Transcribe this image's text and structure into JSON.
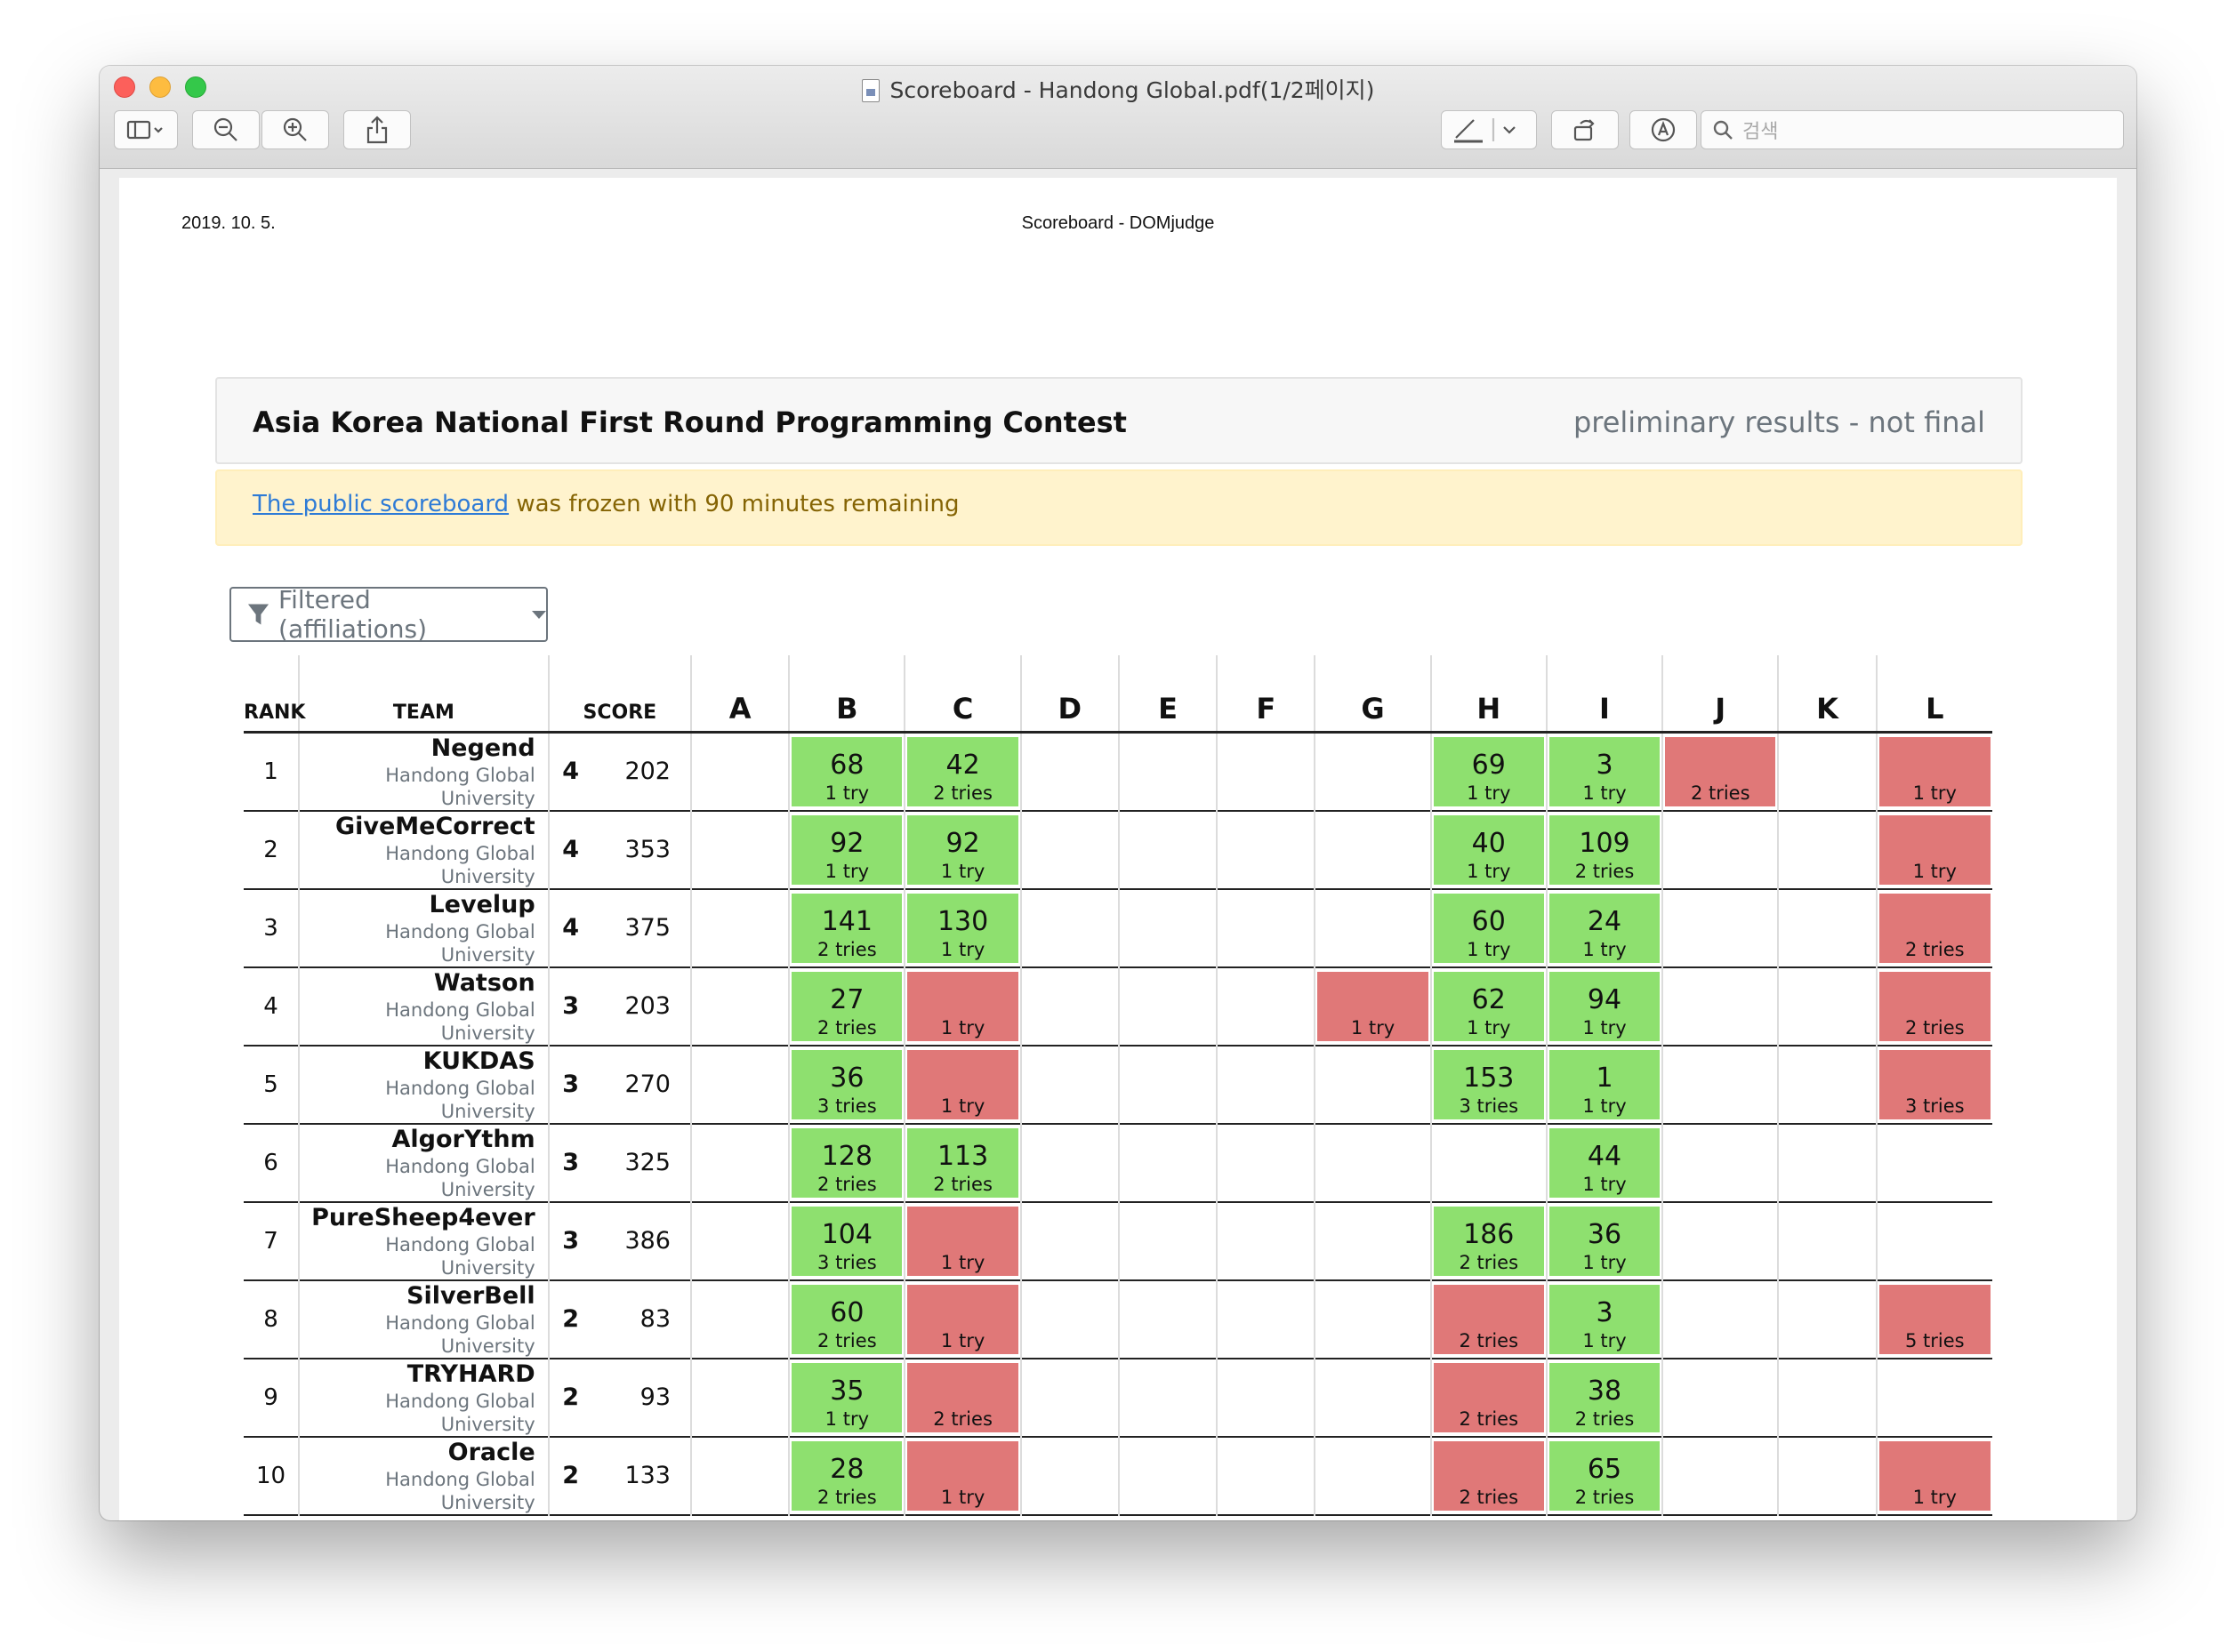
{
  "window": {
    "title": "Scoreboard - Handong Global.pdf(1/2페이지)",
    "search_placeholder": "검색"
  },
  "page_header": {
    "date": "2019. 10. 5.",
    "title": "Scoreboard - DOMjudge"
  },
  "contest": {
    "name": "Asia Korea National First Round Programming Contest",
    "status": "preliminary results - not final"
  },
  "alert": {
    "link_text": "The public scoreboard",
    "text": " was frozen with 90 minutes remaining"
  },
  "filter": {
    "label": "Filtered (affiliations)"
  },
  "columns": {
    "rank": "RANK",
    "team": "TEAM",
    "score": "SCORE"
  },
  "problems": [
    "A",
    "B",
    "C",
    "D",
    "E",
    "F",
    "G",
    "H",
    "I",
    "J",
    "K",
    "L"
  ],
  "colors": {
    "solved": "#8ee06f",
    "failed": "#e07878"
  },
  "teams": [
    {
      "rank": "1",
      "name": "Negend",
      "affiliation": "Handong Global University",
      "solved": "4",
      "penalty": "202",
      "cells": [
        null,
        {
          "s": "ok",
          "time": "68",
          "tries": "1 try"
        },
        {
          "s": "ok",
          "time": "42",
          "tries": "2 tries"
        },
        null,
        null,
        null,
        null,
        {
          "s": "ok",
          "time": "69",
          "tries": "1 try"
        },
        {
          "s": "ok",
          "time": "3",
          "tries": "1 try"
        },
        {
          "s": "bad",
          "time": "",
          "tries": "2 tries"
        },
        null,
        {
          "s": "bad",
          "time": "",
          "tries": "1 try"
        }
      ]
    },
    {
      "rank": "2",
      "name": "GiveMeCorrect",
      "affiliation": "Handong Global University",
      "solved": "4",
      "penalty": "353",
      "cells": [
        null,
        {
          "s": "ok",
          "time": "92",
          "tries": "1 try"
        },
        {
          "s": "ok",
          "time": "92",
          "tries": "1 try"
        },
        null,
        null,
        null,
        null,
        {
          "s": "ok",
          "time": "40",
          "tries": "1 try"
        },
        {
          "s": "ok",
          "time": "109",
          "tries": "2 tries"
        },
        null,
        null,
        {
          "s": "bad",
          "time": "",
          "tries": "1 try"
        }
      ]
    },
    {
      "rank": "3",
      "name": "Levelup",
      "affiliation": "Handong Global University",
      "solved": "4",
      "penalty": "375",
      "cells": [
        null,
        {
          "s": "ok",
          "time": "141",
          "tries": "2 tries"
        },
        {
          "s": "ok",
          "time": "130",
          "tries": "1 try"
        },
        null,
        null,
        null,
        null,
        {
          "s": "ok",
          "time": "60",
          "tries": "1 try"
        },
        {
          "s": "ok",
          "time": "24",
          "tries": "1 try"
        },
        null,
        null,
        {
          "s": "bad",
          "time": "",
          "tries": "2 tries"
        }
      ]
    },
    {
      "rank": "4",
      "name": "Watson",
      "affiliation": "Handong Global University",
      "solved": "3",
      "penalty": "203",
      "cells": [
        null,
        {
          "s": "ok",
          "time": "27",
          "tries": "2 tries"
        },
        {
          "s": "bad",
          "time": "",
          "tries": "1 try"
        },
        null,
        null,
        null,
        {
          "s": "bad",
          "time": "",
          "tries": "1 try"
        },
        {
          "s": "ok",
          "time": "62",
          "tries": "1 try"
        },
        {
          "s": "ok",
          "time": "94",
          "tries": "1 try"
        },
        null,
        null,
        {
          "s": "bad",
          "time": "",
          "tries": "2 tries"
        }
      ]
    },
    {
      "rank": "5",
      "name": "KUKDAS",
      "affiliation": "Handong Global University",
      "solved": "3",
      "penalty": "270",
      "cells": [
        null,
        {
          "s": "ok",
          "time": "36",
          "tries": "3 tries"
        },
        {
          "s": "bad",
          "time": "",
          "tries": "1 try"
        },
        null,
        null,
        null,
        null,
        {
          "s": "ok",
          "time": "153",
          "tries": "3 tries"
        },
        {
          "s": "ok",
          "time": "1",
          "tries": "1 try"
        },
        null,
        null,
        {
          "s": "bad",
          "time": "",
          "tries": "3 tries"
        }
      ]
    },
    {
      "rank": "6",
      "name": "AlgorYthm",
      "affiliation": "Handong Global University",
      "solved": "3",
      "penalty": "325",
      "cells": [
        null,
        {
          "s": "ok",
          "time": "128",
          "tries": "2 tries"
        },
        {
          "s": "ok",
          "time": "113",
          "tries": "2 tries"
        },
        null,
        null,
        null,
        null,
        null,
        {
          "s": "ok",
          "time": "44",
          "tries": "1 try"
        },
        null,
        null,
        null
      ]
    },
    {
      "rank": "7",
      "name": "PureSheep4ever",
      "affiliation": "Handong Global University",
      "solved": "3",
      "penalty": "386",
      "cells": [
        null,
        {
          "s": "ok",
          "time": "104",
          "tries": "3 tries"
        },
        {
          "s": "bad",
          "time": "",
          "tries": "1 try"
        },
        null,
        null,
        null,
        null,
        {
          "s": "ok",
          "time": "186",
          "tries": "2 tries"
        },
        {
          "s": "ok",
          "time": "36",
          "tries": "1 try"
        },
        null,
        null,
        null
      ]
    },
    {
      "rank": "8",
      "name": "SilverBell",
      "affiliation": "Handong Global University",
      "solved": "2",
      "penalty": "83",
      "cells": [
        null,
        {
          "s": "ok",
          "time": "60",
          "tries": "2 tries"
        },
        {
          "s": "bad",
          "time": "",
          "tries": "1 try"
        },
        null,
        null,
        null,
        null,
        {
          "s": "bad",
          "time": "",
          "tries": "2 tries"
        },
        {
          "s": "ok",
          "time": "3",
          "tries": "1 try"
        },
        null,
        null,
        {
          "s": "bad",
          "time": "",
          "tries": "5 tries"
        }
      ]
    },
    {
      "rank": "9",
      "name": "TRYHARD",
      "affiliation": "Handong Global University",
      "solved": "2",
      "penalty": "93",
      "cells": [
        null,
        {
          "s": "ok",
          "time": "35",
          "tries": "1 try"
        },
        {
          "s": "bad",
          "time": "",
          "tries": "2 tries"
        },
        null,
        null,
        null,
        null,
        {
          "s": "bad",
          "time": "",
          "tries": "2 tries"
        },
        {
          "s": "ok",
          "time": "38",
          "tries": "2 tries"
        },
        null,
        null,
        null
      ]
    },
    {
      "rank": "10",
      "name": "Oracle",
      "affiliation": "Handong Global University",
      "solved": "2",
      "penalty": "133",
      "cells": [
        null,
        {
          "s": "ok",
          "time": "28",
          "tries": "2 tries"
        },
        {
          "s": "bad",
          "time": "",
          "tries": "1 try"
        },
        null,
        null,
        null,
        null,
        {
          "s": "bad",
          "time": "",
          "tries": "2 tries"
        },
        {
          "s": "ok",
          "time": "65",
          "tries": "2 tries"
        },
        null,
        null,
        {
          "s": "bad",
          "time": "",
          "tries": "1 try"
        }
      ]
    }
  ]
}
